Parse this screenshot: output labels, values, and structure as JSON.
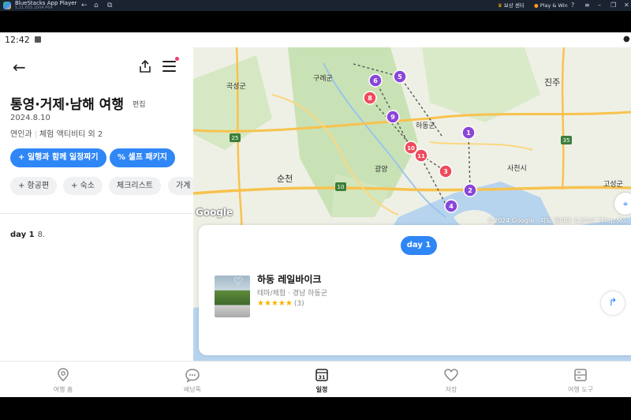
{
  "emulator": {
    "name": "BlueStacks App Player",
    "version": "5.21.655.1004 P64",
    "nav_icons": [
      "back-arrow-icon",
      "home-icon",
      "multi-instance-icon"
    ],
    "reward_label": "보상 센터",
    "play_win_label": "Play & Win",
    "window_icons": [
      "help-icon",
      "menu-icon",
      "minimize-icon",
      "restore-icon",
      "close-icon"
    ]
  },
  "status_bar": {
    "time": "12:42"
  },
  "header": {
    "back_icon": "back-arrow-icon",
    "share_icon": "share-icon",
    "menu_icon": "hamburger-icon"
  },
  "trip": {
    "title": "통영·거제·남해 여행",
    "edit_label": "편집",
    "date": "2024.8.10",
    "companion": "연인과",
    "theme": "체험 액티비티 외 2"
  },
  "actions": {
    "plan_with": "+ 일행과 함께 일정짜기",
    "self_package": "셀프 패키지"
  },
  "chips": [
    "+ 항공편",
    "+ 숙소",
    "체크리스트",
    "가계"
  ],
  "day_section": {
    "label": "day 1",
    "date": "8."
  },
  "map": {
    "labels": [
      "곡성군",
      "구례군",
      "진주",
      "하동군",
      "순천",
      "광양",
      "사천시",
      "고성군",
      "25",
      "10",
      "35"
    ],
    "markers": [
      {
        "num": "1",
        "color": "#8a46d8"
      },
      {
        "num": "2",
        "color": "#8a46d8"
      },
      {
        "num": "3",
        "color": "#ef4a5c"
      },
      {
        "num": "4",
        "color": "#8a46d8"
      },
      {
        "num": "5",
        "color": "#8a46d8"
      },
      {
        "num": "6",
        "color": "#8a46d8"
      },
      {
        "num": "8",
        "color": "#ef4a5c"
      },
      {
        "num": "9",
        "color": "#8a46d8"
      },
      {
        "num": "10",
        "color": "#ef4a5c"
      },
      {
        "num": "11",
        "color": "#ef4a5c"
      }
    ],
    "google_label": "Google",
    "attribution": "©2024 Google · 지도 데이터 ©2024 TMap Mo"
  },
  "card": {
    "day_pill": "day 1",
    "place": {
      "name": "하동 레일바이크",
      "category": "테마/체험 · 경남 하동군",
      "stars": "★★★★★",
      "review_count": "(3)"
    }
  },
  "bottom_nav": [
    {
      "label": "여행 홈",
      "icon": "location-pin-icon",
      "active": false
    },
    {
      "label": "배낭톡",
      "icon": "chat-bubble-icon",
      "active": false
    },
    {
      "label": "일정",
      "icon": "calendar-icon",
      "active": true,
      "icon_text": "31"
    },
    {
      "label": "저장",
      "icon": "heart-icon",
      "active": false
    },
    {
      "label": "여행 도구",
      "icon": "tools-icon",
      "active": false
    }
  ],
  "colors": {
    "accent": "#2f86f6",
    "marker_purple": "#8a46d8",
    "marker_red": "#ef4a5c",
    "notification": "#ef3e6b"
  }
}
